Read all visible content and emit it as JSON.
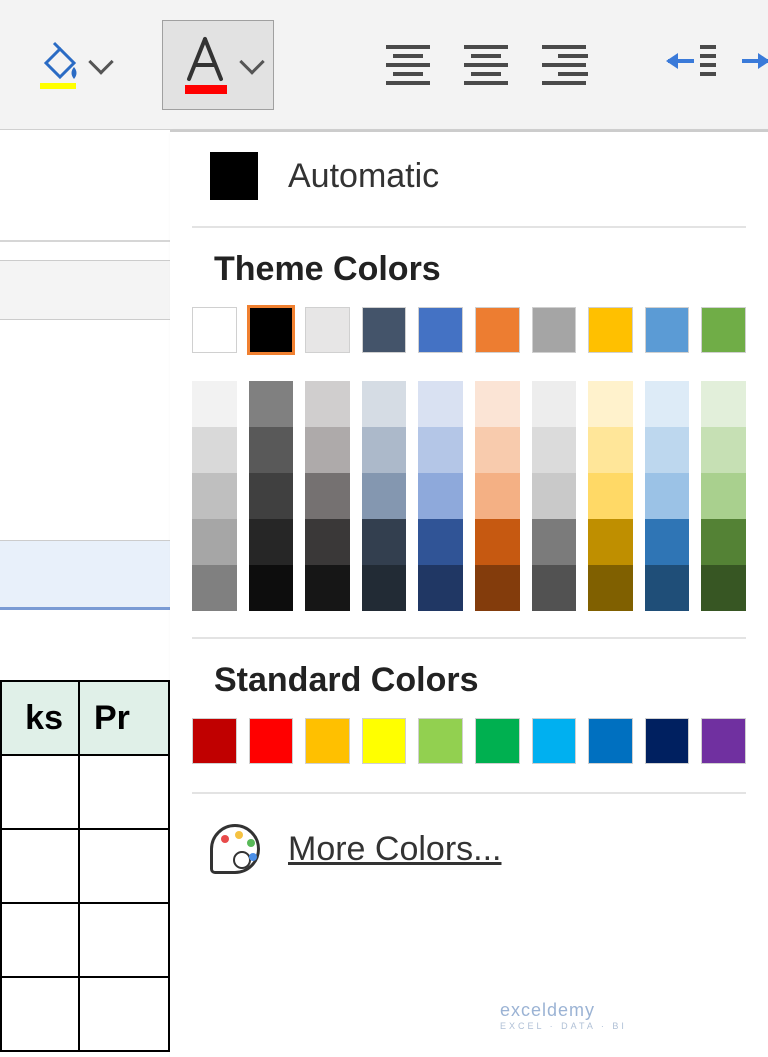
{
  "ribbon": {
    "fill_button": "fill-color",
    "font_color_button": "font-color"
  },
  "panel": {
    "automatic_label": "Automatic",
    "theme_title": "Theme Colors",
    "standard_title": "Standard Colors",
    "more_colors_label": "More Colors...",
    "theme_row": [
      "#ffffff",
      "#000000",
      "#e7e6e6",
      "#44546a",
      "#4472c4",
      "#ed7d31",
      "#a5a5a5",
      "#ffc000",
      "#5b9bd5",
      "#70ad47"
    ],
    "theme_shades": [
      [
        "#f2f2f2",
        "#d9d9d9",
        "#bfbfbf",
        "#a6a6a6",
        "#808080"
      ],
      [
        "#808080",
        "#595959",
        "#404040",
        "#262626",
        "#0d0d0d"
      ],
      [
        "#d0cece",
        "#aeaaaa",
        "#757171",
        "#3a3838",
        "#161616"
      ],
      [
        "#d5dce4",
        "#acb9ca",
        "#8497b0",
        "#333f4f",
        "#222b35"
      ],
      [
        "#d9e1f2",
        "#b4c6e7",
        "#8ea9db",
        "#305496",
        "#203764"
      ],
      [
        "#fbe4d5",
        "#f8cbad",
        "#f4b084",
        "#c65911",
        "#833c0c"
      ],
      [
        "#ededed",
        "#dbdbdb",
        "#c9c9c9",
        "#7b7b7b",
        "#525252"
      ],
      [
        "#fff2cc",
        "#ffe699",
        "#ffd966",
        "#bf8f00",
        "#806000"
      ],
      [
        "#ddebf7",
        "#bdd7ee",
        "#9bc2e6",
        "#2f75b5",
        "#1f4e78"
      ],
      [
        "#e2efda",
        "#c6e0b4",
        "#a9d08e",
        "#548235",
        "#375623"
      ]
    ],
    "standard_row": [
      "#c00000",
      "#ff0000",
      "#ffc000",
      "#ffff00",
      "#92d050",
      "#00b050",
      "#00b0f0",
      "#0070c0",
      "#002060",
      "#7030a0"
    ],
    "selected_theme_index": 1
  },
  "sheet": {
    "col_header_1_partial": "ks",
    "col_header_2_partial": "Pr"
  },
  "watermark": {
    "brand": "exceldemy",
    "tag": "EXCEL · DATA · BI"
  }
}
